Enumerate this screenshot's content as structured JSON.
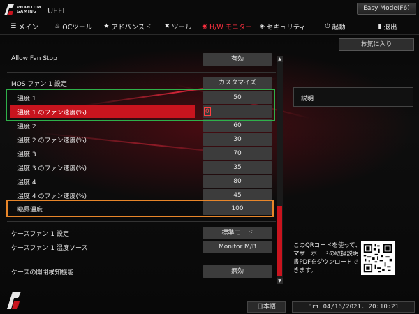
{
  "header": {
    "brand_line1": "PHANTOM",
    "brand_line2": "GAMING",
    "uefi": "UEFI",
    "easy_mode": "Easy Mode(F6)"
  },
  "menu": [
    {
      "icon": "list-icon",
      "glyph": "☰",
      "label": "メイン"
    },
    {
      "icon": "flame-icon",
      "glyph": "🔥",
      "label": "OCツール"
    },
    {
      "icon": "star-icon",
      "glyph": "★",
      "label": "アドバンスド"
    },
    {
      "icon": "wrench-icon",
      "glyph": "✖",
      "label": "ツール"
    },
    {
      "icon": "monitor-icon",
      "glyph": "◉",
      "label": "H/W モニター"
    },
    {
      "icon": "shield-icon",
      "glyph": "◈",
      "label": "セキュリティ"
    },
    {
      "icon": "power-icon",
      "glyph": "⏻",
      "label": "起動"
    },
    {
      "icon": "exit-icon",
      "glyph": "▮",
      "label": "退出"
    }
  ],
  "settings": [
    {
      "label": "Allow Fan Stop",
      "value": "有効"
    },
    {
      "label": "MOS ファン 1 設定",
      "value": "カスタマイズ"
    },
    {
      "label": "温度 1",
      "value": "50"
    },
    {
      "label": "温度 1 のファン速度(%)",
      "value": "0"
    },
    {
      "label": "温度 2",
      "value": "60"
    },
    {
      "label": "温度 2 のファン速度(%)",
      "value": "30"
    },
    {
      "label": "温度 3",
      "value": "70"
    },
    {
      "label": "温度 3 のファン速度(%)",
      "value": "35"
    },
    {
      "label": "温度 4",
      "value": "80"
    },
    {
      "label": "温度 4 のファン速度(%)",
      "value": "45"
    },
    {
      "label": "臨界温度",
      "value": "100"
    },
    {
      "label": "ケースファン 1 設定",
      "value": "標準モード"
    },
    {
      "label": "ケースファン 1 温度ソース",
      "value": "Monitor M/B"
    },
    {
      "label": "ケースの開閉検知機能",
      "value": "無効"
    }
  ],
  "right": {
    "favorite": "お気に入り",
    "description": "説明",
    "qr_text": "このQRコードを使って、マザーボードの取扱説明書PDFをダウンロードできます。"
  },
  "footer": {
    "language": "日本語",
    "datetime": "Fri 04/16/2021. 20:10:21"
  },
  "colors": {
    "accent": "#c8141e",
    "green_box": "#2fb04a",
    "orange_box": "#e8862a"
  }
}
